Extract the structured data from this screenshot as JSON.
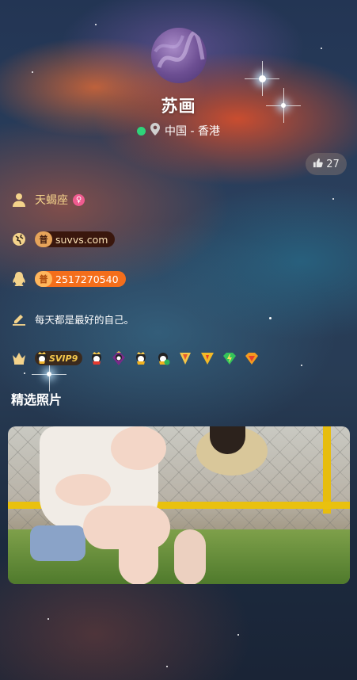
{
  "profile": {
    "name": "苏画",
    "location": "中国 - 香港",
    "likes": "27"
  },
  "info": {
    "zodiac": "天蝎座",
    "website": "suvvs.com",
    "website_icon_text": "普",
    "qq": "2517270540",
    "qq_icon_text": "普",
    "motto": "每天都是最好的自己。",
    "vip_badge": "SVIP9"
  },
  "gallery": {
    "title": "精选照片"
  },
  "colors": {
    "accent_gold": "#f4d38b",
    "online": "#2ed47a",
    "female": "#ef5b8f",
    "qq_pill": "#f46e1b"
  },
  "icons": [
    "user-icon",
    "globe-icon",
    "qq-penguin-icon",
    "pen-icon",
    "crown-icon",
    "map-pin-icon",
    "thumbs-up-icon"
  ]
}
